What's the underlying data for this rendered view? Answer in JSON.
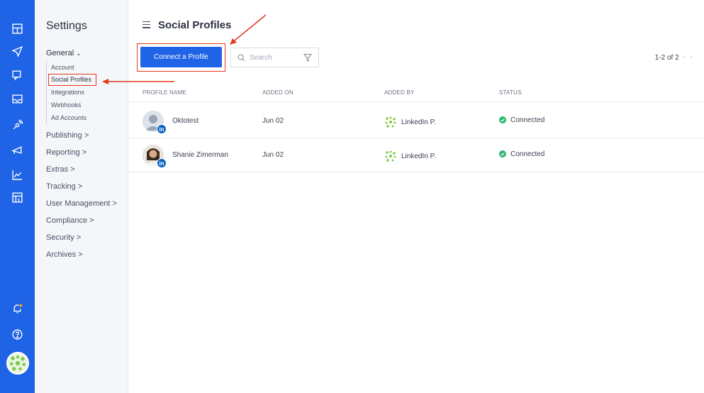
{
  "nav": {
    "title": "Settings",
    "group": "General",
    "subitems": [
      "Account",
      "Social Profiles",
      "Integrations",
      "Webhooks",
      "Ad Accounts"
    ],
    "sections": [
      "Publishing >",
      "Reporting >",
      "Extras >",
      "Tracking >",
      "User Management >",
      "Compliance >",
      "Security >",
      "Archives >"
    ]
  },
  "rail": {
    "icons": [
      "dashboard-icon",
      "send-icon",
      "messages-icon",
      "inbox-icon",
      "listening-icon",
      "campaigns-icon",
      "analytics-icon",
      "reports-icon",
      "notifications-icon",
      "help-icon"
    ]
  },
  "header": {
    "title": "Social Profiles"
  },
  "toolbar": {
    "connect_label": "Connect a Profile",
    "search_placeholder": "Search",
    "pagination": "1-2 of 2"
  },
  "table": {
    "columns": [
      "PROFILE NAME",
      "ADDED ON",
      "ADDED BY",
      "STATUS"
    ],
    "rows": [
      {
        "name": "Oktotest",
        "added_on": "Jun 02",
        "added_by": "LinkedIn P.",
        "status": "Connected",
        "network_badge": "in"
      },
      {
        "name": "Shanie Zimerman",
        "added_on": "Jun 02",
        "added_by": "LinkedIn P.",
        "status": "Connected",
        "network_badge": "in"
      }
    ]
  },
  "colors": {
    "accent": "#1f63e6",
    "status_connected": "#2bb673",
    "annotation": "#e03a1e",
    "linkedin": "#0a66c2"
  }
}
